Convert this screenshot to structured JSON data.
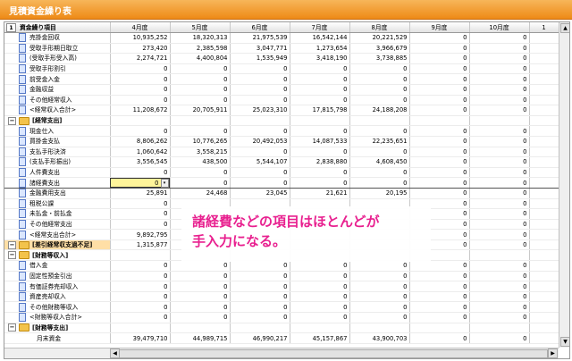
{
  "window": {
    "title": "見積資金繰り表"
  },
  "header": {
    "index": "1",
    "label": "資金繰り項目",
    "months": [
      "4月度",
      "5月度",
      "6月度",
      "7月度",
      "8月度",
      "9月度",
      "10月度",
      "1"
    ]
  },
  "rows": [
    {
      "type": "item",
      "name": "売掛金回収",
      "values": [
        "10,935,252",
        "18,320,313",
        "21,975,539",
        "16,542,144",
        "20,221,529",
        "0",
        "0"
      ]
    },
    {
      "type": "item",
      "name": "受取手形期日取立",
      "values": [
        "273,420",
        "2,385,598",
        "3,047,771",
        "1,273,654",
        "3,966,679",
        "0",
        "0"
      ]
    },
    {
      "type": "item",
      "name": "(受取手形受入高)",
      "values": [
        "2,274,721",
        "4,400,804",
        "1,535,949",
        "3,418,190",
        "3,738,885",
        "0",
        "0"
      ]
    },
    {
      "type": "item",
      "name": "受取手形割引",
      "values": [
        "0",
        "0",
        "0",
        "0",
        "0",
        "0",
        "0"
      ]
    },
    {
      "type": "item",
      "name": "前受金入金",
      "values": [
        "0",
        "0",
        "0",
        "0",
        "0",
        "0",
        "0"
      ]
    },
    {
      "type": "item",
      "name": "金融収益",
      "values": [
        "0",
        "0",
        "0",
        "0",
        "0",
        "0",
        "0"
      ]
    },
    {
      "type": "item",
      "name": "その他経常収入",
      "values": [
        "0",
        "0",
        "0",
        "0",
        "0",
        "0",
        "0"
      ]
    },
    {
      "type": "item",
      "name": "<経常収入合計>",
      "values": [
        "11,208,672",
        "20,705,911",
        "25,023,310",
        "17,815,798",
        "24,188,208",
        "0",
        "0"
      ]
    },
    {
      "type": "cat",
      "name": "[経常支出]",
      "values": [
        "",
        "",
        "",
        "",
        "",
        "",
        ""
      ]
    },
    {
      "type": "item",
      "name": "現金仕入",
      "values": [
        "0",
        "0",
        "0",
        "0",
        "0",
        "0",
        "0"
      ]
    },
    {
      "type": "item",
      "name": "買掛金支払",
      "values": [
        "8,806,262",
        "10,776,265",
        "20,492,053",
        "14,087,533",
        "22,235,651",
        "0",
        "0"
      ]
    },
    {
      "type": "item",
      "name": "支払手形決済",
      "values": [
        "1,060,642",
        "3,558,215",
        "0",
        "0",
        "0",
        "0",
        "0"
      ]
    },
    {
      "type": "item",
      "name": "(支払手形振出)",
      "values": [
        "3,556,545",
        "438,500",
        "5,544,107",
        "2,838,880",
        "4,608,450",
        "0",
        "0"
      ]
    },
    {
      "type": "item",
      "name": "人件費支出",
      "values": [
        "0",
        "0",
        "0",
        "0",
        "0",
        "0",
        "0"
      ]
    },
    {
      "type": "item",
      "name": "諸経費支出",
      "values": [
        "0",
        "0",
        "0",
        "0",
        "0",
        "0",
        "0"
      ],
      "selected": true
    },
    {
      "type": "item",
      "name": "金融費用支出",
      "values": [
        "25,891",
        "24,468",
        "23,045",
        "21,621",
        "20,195",
        "0",
        "0"
      ]
    },
    {
      "type": "item",
      "name": "租税公課",
      "values": [
        "0",
        "",
        "",
        "",
        "",
        "0",
        "0"
      ]
    },
    {
      "type": "item",
      "name": "未払金・前払金",
      "values": [
        "0",
        "",
        "",
        "",
        "",
        "0",
        "0"
      ]
    },
    {
      "type": "item",
      "name": "その他経常支出",
      "values": [
        "0",
        "",
        "",
        "",
        "",
        "0",
        "0"
      ]
    },
    {
      "type": "item",
      "name": "<経常支出合計>",
      "values": [
        "9,892,795",
        "",
        "",
        "",
        "",
        "0",
        "0"
      ]
    },
    {
      "type": "cat",
      "name": "[差引経常収支過不足]",
      "values": [
        "1,315,877",
        "",
        "",
        "",
        "",
        "0",
        "0"
      ],
      "highlight": true
    },
    {
      "type": "cat",
      "name": "[財務等収入]",
      "values": [
        "",
        "",
        "",
        "",
        "",
        "",
        ""
      ]
    },
    {
      "type": "item",
      "name": "借入金",
      "values": [
        "0",
        "0",
        "0",
        "0",
        "0",
        "0",
        "0"
      ]
    },
    {
      "type": "item",
      "name": "固定性預金引出",
      "values": [
        "0",
        "0",
        "0",
        "0",
        "0",
        "0",
        "0"
      ]
    },
    {
      "type": "item",
      "name": "有価証券売却収入",
      "values": [
        "0",
        "0",
        "0",
        "0",
        "0",
        "0",
        "0"
      ]
    },
    {
      "type": "item",
      "name": "資産売却収入",
      "values": [
        "0",
        "0",
        "0",
        "0",
        "0",
        "0",
        "0"
      ]
    },
    {
      "type": "item",
      "name": "その他財務等収入",
      "values": [
        "0",
        "0",
        "0",
        "0",
        "0",
        "0",
        "0"
      ]
    },
    {
      "type": "item",
      "name": "<財務等収入合計>",
      "values": [
        "0",
        "0",
        "0",
        "0",
        "0",
        "0",
        "0"
      ]
    },
    {
      "type": "cat",
      "name": "[財務等支出]",
      "values": [
        "",
        "",
        "",
        "",
        "",
        "",
        ""
      ]
    },
    {
      "type": "total",
      "name": "月末資金",
      "values": [
        "39,479,710",
        "44,989,715",
        "46,990,217",
        "45,157,867",
        "43,900,703",
        "0",
        "0"
      ]
    }
  ],
  "callout": {
    "line1": "諸経費などの項目はほとんどが",
    "line2": "手入力になる。"
  },
  "colors": {
    "title_bar": "#ee8a16",
    "callout_text": "#e8208f",
    "selected_cell": "#fff49a"
  }
}
